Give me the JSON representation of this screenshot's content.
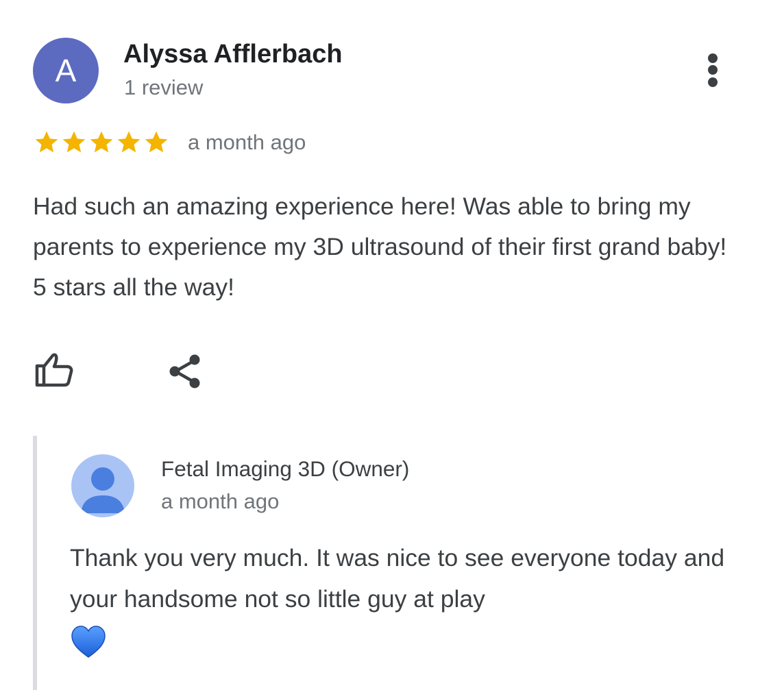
{
  "review": {
    "avatar_letter": "A",
    "avatar_color": "#5c6bc0",
    "reviewer_name": "Alyssa Afflerbach",
    "review_count": "1 review",
    "rating": 5,
    "rating_max": 5,
    "star_color": "#f4b400",
    "date": "a month ago",
    "text": "Had such an amazing experience here! Was able to bring my parents to experience my 3D ultrasound of their first grand baby! 5 stars all the way!",
    "icons": {
      "more": "more-vert-icon",
      "like": "thumbs-up-icon",
      "share": "share-icon"
    }
  },
  "owner_reply": {
    "owner_name": "Fetal Imaging 3D (Owner)",
    "date": "a month ago",
    "text": "Thank you very much. It was nice to see everyone today and your handsome not so little guy at play",
    "emoji": "blue-heart-icon",
    "avatar_icon": "person-icon",
    "avatar_color": "#a9c3f5",
    "avatar_figure_color": "#4a7fe0"
  }
}
